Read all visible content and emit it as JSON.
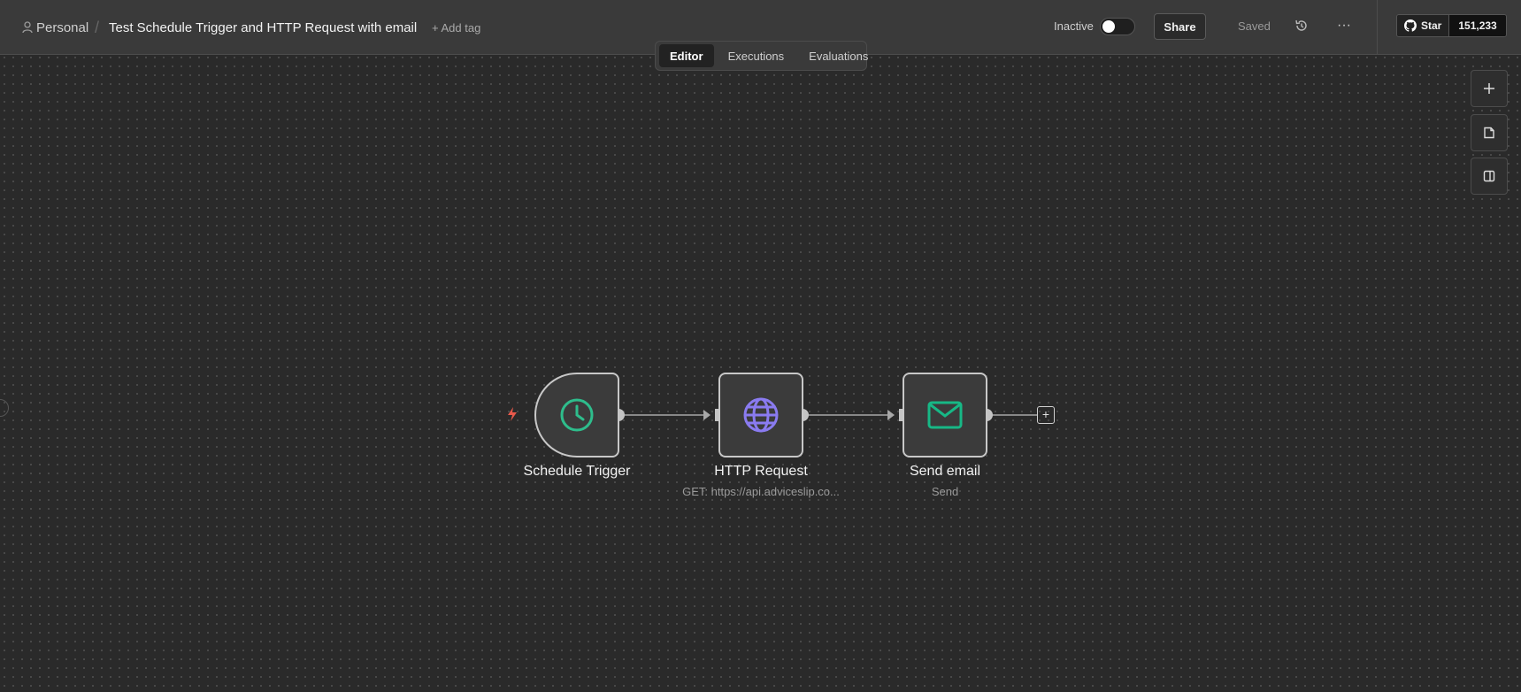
{
  "header": {
    "breadcrumb_project": "Personal",
    "breadcrumb_separator": "/",
    "workflow_title": "Test Schedule Trigger and HTTP Request with email",
    "add_tag": "+ Add tag",
    "status_label": "Inactive",
    "active": false,
    "share_label": "Share",
    "saved_label": "Saved",
    "more_label": "···",
    "github": {
      "star_label": "Star",
      "count": "151,233"
    }
  },
  "tabs": [
    {
      "label": "Editor",
      "active": true
    },
    {
      "label": "Executions",
      "active": false
    },
    {
      "label": "Evaluations",
      "active": false
    }
  ],
  "side_tools": [
    "plus-icon",
    "sticky-note-icon",
    "panel-icon"
  ],
  "nodes": [
    {
      "name": "Schedule Trigger",
      "subtitle": "",
      "icon": "clock-icon",
      "icon_color": "#2ebd8c"
    },
    {
      "name": "HTTP Request",
      "subtitle": "GET: https://api.adviceslip.co...",
      "icon": "globe-icon",
      "icon_color": "#8a7bf0"
    },
    {
      "name": "Send email",
      "subtitle": "Send",
      "icon": "mail-icon",
      "icon_color": "#17b886"
    }
  ],
  "add_node_label": "+",
  "colors": {
    "trigger_bolt": "#e8594b",
    "canvas": "#2a2a2a",
    "node_border": "#c8c8c8"
  }
}
